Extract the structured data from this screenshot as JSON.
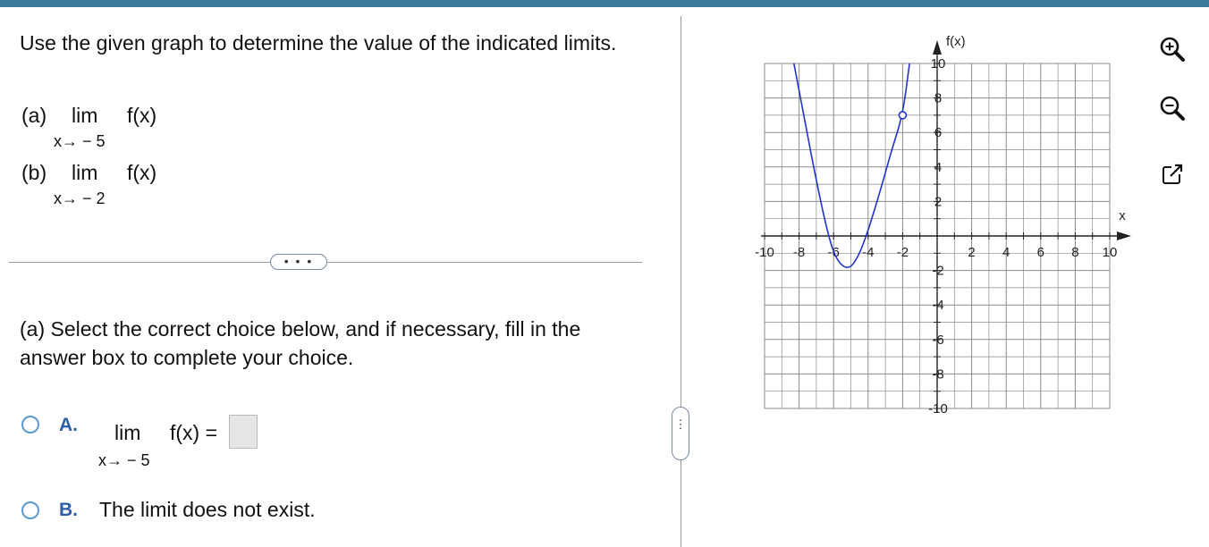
{
  "question": {
    "text": "Use the given graph to determine the value of the indicated limits.",
    "parts": [
      {
        "label": "(a)",
        "lim": "lim",
        "func": "f(x)",
        "approach": "x→ − 5"
      },
      {
        "label": "(b)",
        "lim": "lim",
        "func": "f(x)",
        "approach": "x→ − 2"
      }
    ]
  },
  "more_button": "• • •",
  "side_handle": "⋮",
  "prompt": "(a) Select the correct choice below, and if necessary, fill in the answer box to complete your choice.",
  "choices": [
    {
      "letter": "A.",
      "lim": "lim",
      "func": "f(x) =",
      "approach": "x→ − 5",
      "answer_value": ""
    },
    {
      "letter": "B.",
      "text": "The limit does not exist."
    }
  ],
  "tools": [
    "zoom-in-icon",
    "zoom-out-icon",
    "popout-icon"
  ],
  "colors": {
    "accent": "#3b7a9c",
    "curve": "#2233cc",
    "choice_letter": "#2f5da8",
    "radio": "#5a9bd4"
  },
  "chart_data": {
    "type": "line",
    "xlabel": "x",
    "ylabel": "f(x)",
    "xlim": [
      -10,
      10
    ],
    "ylim": [
      -10,
      10
    ],
    "grid": true,
    "x_ticks": [
      "-10",
      "-8",
      "-6",
      "-4",
      "-2",
      "2",
      "4",
      "6",
      "8",
      "10"
    ],
    "y_ticks": [
      "10",
      "8",
      "6",
      "4",
      "2",
      "-2",
      "-4",
      "-6",
      "-8",
      "-10"
    ],
    "series": [
      {
        "points": [
          [
            -8.3,
            10
          ],
          [
            -7.6,
            6.3
          ],
          [
            -7,
            3.2
          ],
          [
            -6.4,
            0.4
          ],
          [
            -5.9,
            -1.3
          ],
          [
            -5.2,
            -2
          ],
          [
            -4.6,
            -1.3
          ],
          [
            -4,
            0.3
          ],
          [
            -3.3,
            2.6
          ],
          [
            -2.6,
            5.1
          ],
          [
            -2,
            7
          ],
          [
            -1.6,
            10
          ]
        ]
      }
    ],
    "open_points": [
      [
        -2,
        7
      ]
    ]
  }
}
